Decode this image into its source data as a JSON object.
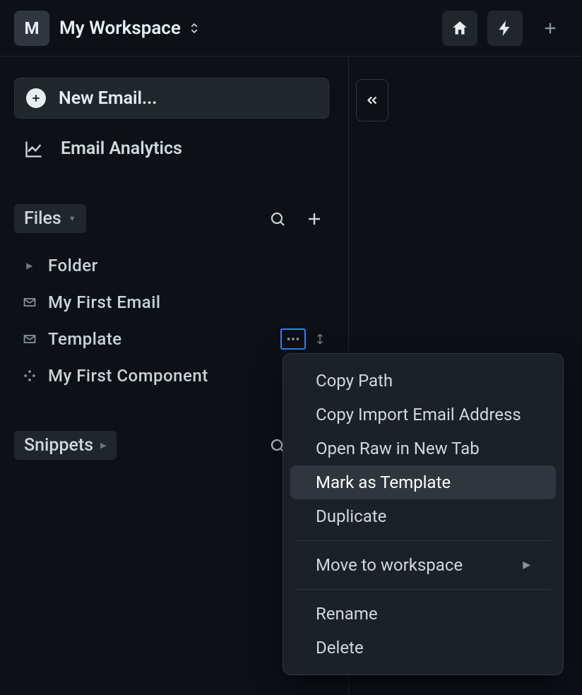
{
  "topbar": {
    "workspace_initial": "M",
    "workspace_name": "My Workspace"
  },
  "sidebar": {
    "new_email_label": "New Email...",
    "analytics_label": "Email Analytics",
    "files_header": "Files",
    "snippets_header": "Snippets",
    "files": [
      {
        "name": "Folder",
        "type": "folder"
      },
      {
        "name": "My First Email",
        "type": "email"
      },
      {
        "name": "Template",
        "type": "email",
        "active_more": true
      },
      {
        "name": "My First Component",
        "type": "component"
      }
    ]
  },
  "context_menu": {
    "items": [
      {
        "label": "Copy Path"
      },
      {
        "label": "Copy Import Email Address"
      },
      {
        "label": "Open Raw in New Tab"
      },
      {
        "label": "Mark as Template",
        "hovered": true
      },
      {
        "label": "Duplicate"
      }
    ],
    "move_label": "Move to workspace",
    "rename_label": "Rename",
    "delete_label": "Delete"
  }
}
